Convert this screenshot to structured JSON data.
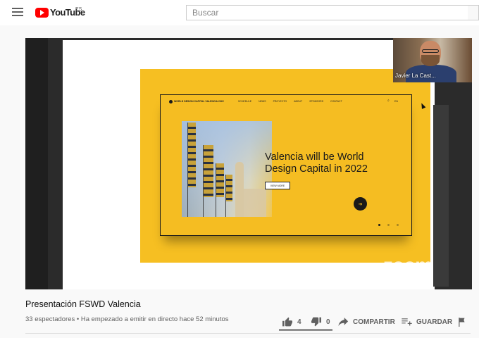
{
  "header": {
    "logo_text": "YouTube",
    "country_code": "ES",
    "search_placeholder": "Buscar",
    "icons": {
      "menu": "menu-icon",
      "logo": "youtube-logo-icon",
      "search": "search-icon"
    }
  },
  "player": {
    "slide": {
      "site_name": "WORLD DESIGN CAPITAL VALENCIA 2022",
      "nav_links": [
        "SCHEDULE",
        "NEWS",
        "PROYECTO",
        "ABOUT",
        "SPONSORS",
        "CONTACT"
      ],
      "lang": "EN",
      "headline_line1": "Valencia will be World",
      "headline_line2": "Design Capital in 2022",
      "cta": "VIEW MORE",
      "carousel_active": 1,
      "carousel_count": 3
    },
    "webcam_name": "Javier La Cast...",
    "watermark": "zoom"
  },
  "video": {
    "title": "Presentación FSWD Valencia",
    "viewers": "33 espectadores",
    "separator": "•",
    "status": "Ha empezado a emitir en directo hace 52 minutos"
  },
  "actions": {
    "likes": "4",
    "dislikes": "0",
    "share_label": "COMPARTIR",
    "save_label": "GUARDAR",
    "like_ratio": 1.0,
    "icons": {
      "like": "thumbs-up-icon",
      "dislike": "thumbs-down-icon",
      "share": "share-arrow-icon",
      "save": "playlist-add-icon",
      "report": "flag-icon"
    }
  },
  "colors": {
    "brand_red": "#ff0000",
    "slide_yellow": "#f6bf22",
    "text_secondary": "#606060"
  }
}
